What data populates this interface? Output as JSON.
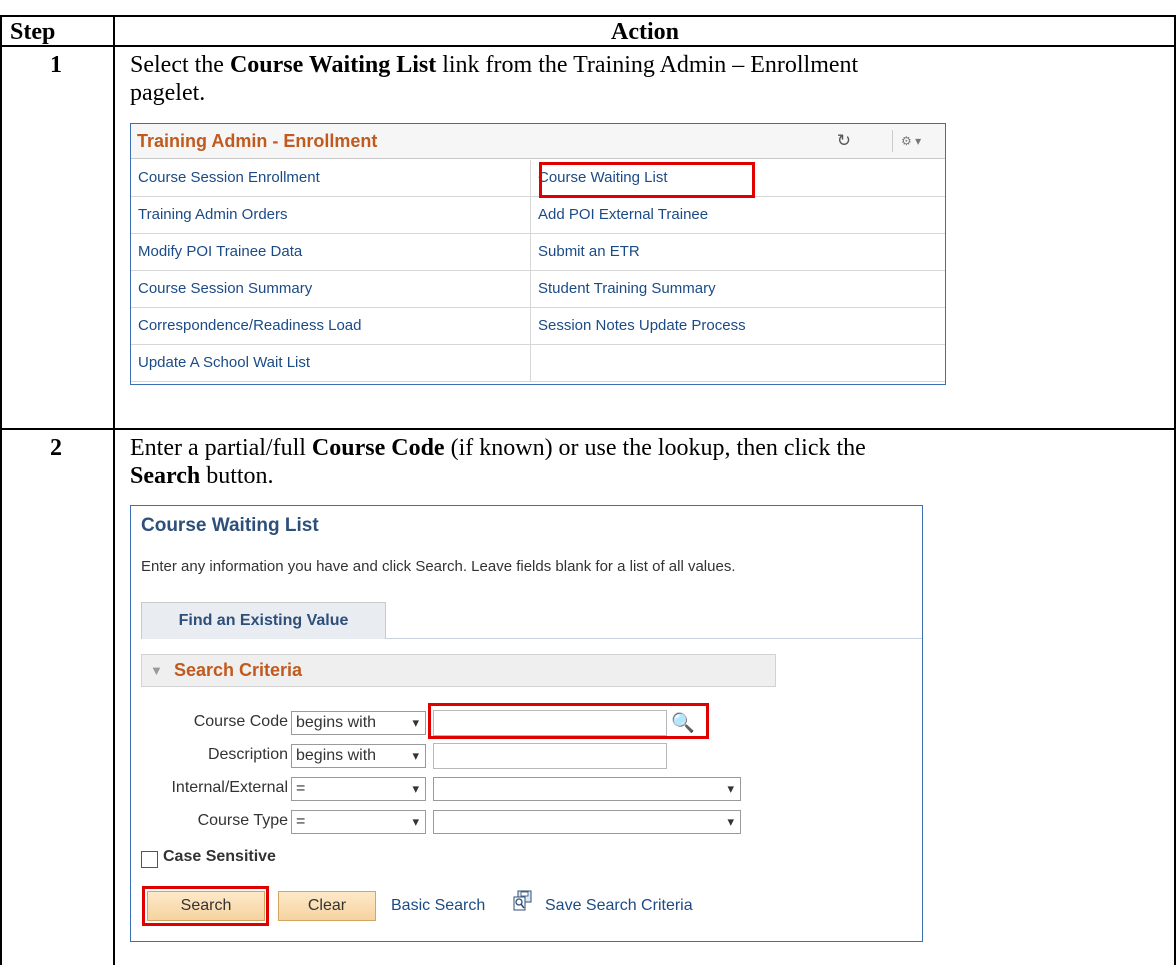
{
  "header": {
    "step": "Step",
    "action": "Action"
  },
  "steps": [
    {
      "number": "1",
      "line1_pre": "Select the ",
      "line1_bold": "Course Waiting List",
      "line1_post": " link from the Training Admin – Enrollment",
      "line2": "pagelet."
    },
    {
      "number": "2",
      "line1_pre": "Enter a partial/full ",
      "line1_bold": "Course Code",
      "line1_post": " (if known) or use the lookup, then click the",
      "line2_bold": "Search",
      "line2_post": " button."
    }
  ],
  "pagelet": {
    "title": "Training Admin - Enrollment",
    "refresh_icon": "↻",
    "gear_icon": "⚙ ▾",
    "rows": [
      [
        "Course Session Enrollment",
        "Course Waiting List"
      ],
      [
        "Training Admin Orders",
        "Add POI External Trainee"
      ],
      [
        "Modify POI Trainee Data",
        "Submit an ETR"
      ],
      [
        "Course Session Summary",
        "Student Training Summary"
      ],
      [
        "Correspondence/Readiness Load",
        "Session Notes Update Process"
      ],
      [
        "Update A School Wait List",
        ""
      ]
    ]
  },
  "search_page": {
    "title": "Course Waiting List",
    "instructions": "Enter any information you have and click Search. Leave fields blank for a list of all values.",
    "tab_label": "Find an Existing Value",
    "criteria_label": "Search Criteria",
    "fields": [
      {
        "label": "Course Code",
        "operator": "begins with",
        "value": ""
      },
      {
        "label": "Description",
        "operator": "begins with",
        "value": ""
      },
      {
        "label": "Internal/External",
        "operator": "=",
        "value": ""
      },
      {
        "label": "Course Type",
        "operator": "=",
        "value": ""
      }
    ],
    "case_sensitive_label": "Case Sensitive",
    "search_label": "Search",
    "clear_label": "Clear",
    "basic_search_label": "Basic Search",
    "save_criteria_label": "Save Search Criteria"
  },
  "colors": {
    "highlight": "#e00000",
    "link": "#1b4b86",
    "accent": "#c05a1e"
  }
}
